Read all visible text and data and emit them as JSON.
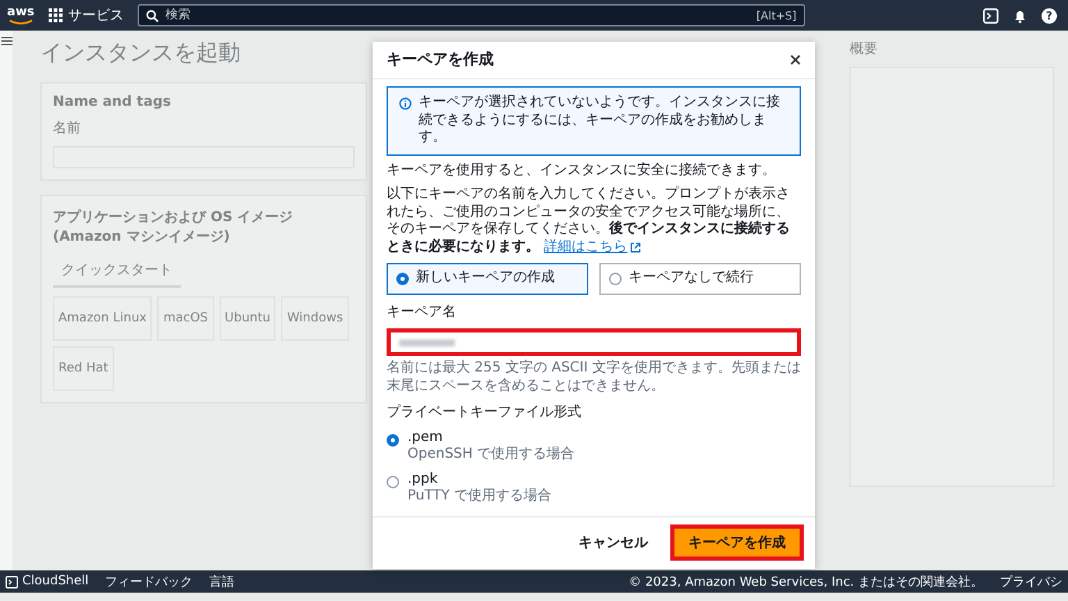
{
  "top_nav": {
    "logo": "aws",
    "services_label": "サービス",
    "help_glyph": "?",
    "search": {
      "placeholder": "検索",
      "shortcut": "[Alt+S]"
    }
  },
  "background": {
    "page_title": "インスタンスを起動",
    "name_section": {
      "title": "Name and tags",
      "field_label": "名前"
    },
    "ami_section": {
      "title": "アプリケーションおよび OS イメージ (Amazon マシンイメージ)",
      "tab": "クイックスタート",
      "os_tiles": [
        "Amazon Linux",
        "macOS",
        "Ubuntu",
        "Windows",
        "Red Hat"
      ]
    },
    "summary": {
      "title": "概要"
    }
  },
  "dialog": {
    "title": "キーペアを作成",
    "info": "キーペアが選択されていないようです。インスタンスに接続できるようにするには、キーペアの作成をお勧めします。",
    "intro": "キーペアを使用すると、インスタンスに安全に接続できます。",
    "instructions": "以下にキーペアの名前を入力してください。プロンプトが表示されたら、ご使用のコンピュータの安全でアクセス可能な場所に、そのキーペアを保存してください。**後でインスタンスに接続するときに必要になります。**",
    "link": "詳細はこちら",
    "options": [
      {
        "label": "新しいキーペアの作成",
        "selected": true
      },
      {
        "label": "キーペアなしで続行",
        "selected": false
      }
    ],
    "name_field": {
      "label": "キーペア名",
      "highlighted": true
    },
    "hint": "名前には最大 255 文字の ASCII 文字を使用できます。先頭または末尾にスペースを含めることはできません。",
    "format": {
      "label": "プライベートキーファイル形式",
      "options": [
        {
          "label": ".pem",
          "description": "OpenSSH で使用する場合",
          "selected": true
        },
        {
          "label": ".ppk",
          "description": "PuTTY で使用する場合",
          "selected": false
        }
      ]
    },
    "cancel": "キャンセル",
    "create": {
      "label": "キーペアを作成",
      "highlighted": true
    }
  },
  "footer": {
    "cloudshell": "CloudShell",
    "feedback": "フィードバック",
    "language": "言語",
    "copyright": "© 2023, Amazon Web Services, Inc. またはその関連会社。",
    "privacy": "プライバシ"
  }
}
